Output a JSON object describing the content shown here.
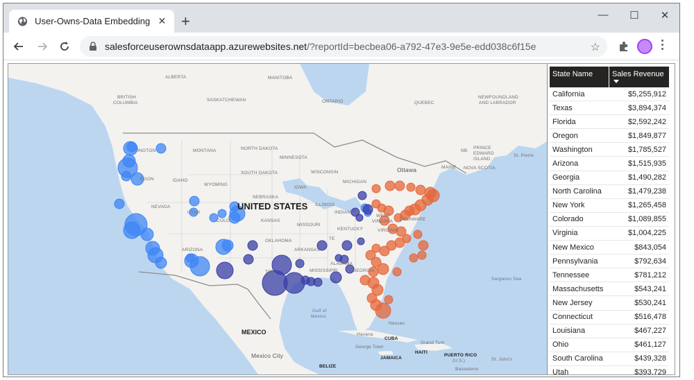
{
  "browser": {
    "tab_title": "User-Owns-Data Embedding App",
    "tab_close": "✕",
    "new_tab": "+",
    "window": {
      "minimize": "—",
      "maximize": "☐",
      "close": "✕"
    },
    "url_host": "salesforceuserownsdataapp.azurewebsites.net",
    "url_path": "/?reportId=becbea06-a792-47e3-9e5e-edd038c6f15e"
  },
  "map": {
    "labels": {
      "alberta": "ALBERTA",
      "manitoba": "MANITOBA",
      "british_columbia_1": "BRITISH",
      "british_columbia_2": "COLUMBIA",
      "saskatchewan": "SASKATCHEWAN",
      "ontario": "ONTARIO",
      "quebec": "QUEBEC",
      "newfoundland_1": "NEWFOUNDLAND",
      "newfoundland_2": "AND LABRADOR",
      "washington": "INGTON",
      "montana": "MONTANA",
      "north_dakota": "NORTH DAKOTA",
      "minnesota": "MINNESOTA",
      "south_dakota": "SOUTH DAKOTA",
      "wisconsin": "WISCONSIN",
      "idaho": "IDAHO",
      "wyoming": "WYOMING",
      "oregon": "EGON",
      "iowa": "IOWA",
      "michigan": "MICHIGAN",
      "nebraska": "NEBRASKA",
      "nevada": "NEVADA",
      "utah": "UTAH",
      "illinois": "ILLINOIS",
      "indiana": "INDIAN",
      "colorado": "COLO",
      "kansas": "KANSAS",
      "missouri": "MISSOURI",
      "kentucky": "KENTUCKY",
      "west_virginia_1": "WEST",
      "west_virginia_2": "VIRGINIA",
      "virginia": "VIRGINIA",
      "delaware": "DELAWARE",
      "oklahoma": "OKLAHOMA",
      "arkansas": "ARKANSAS",
      "tennessee": "TE",
      "arizona": "ARIZONA",
      "texas": "TEX",
      "mississippi": "MISSISSIPPI",
      "alabama": "ALABAMA",
      "georgia": "GEORGIA",
      "nb": "NB",
      "prince_edward_1": "PRINCE",
      "prince_edward_2": "EDWARD",
      "prince_edward_3": "ISLAND",
      "maine": "MAINE",
      "nova_scotia": "NOVA SCOTIA",
      "st_pierre": "St. Pierre",
      "ottawa": "Ottawa",
      "sargasso": "Sargasso Sea",
      "gulf_1": "Gulf of",
      "gulf_2": "Mexico",
      "nassau": "Nassau",
      "havana": "Havana",
      "cuba": "CUBA",
      "grand_turk": "Grand Turk",
      "george_town": "George Town",
      "haiti": "HAITI",
      "puerto_rico_1": "PUERTO RICO",
      "puerto_rico_2": "(U.S.)",
      "st_johns": "St. John's",
      "basseterre": "Basseterre",
      "jamaica": "JAMAICA",
      "mexico": "MEXICO",
      "mexico_city": "Mexico City",
      "belize": "BELIZE"
    },
    "country_title": "UNITED STATES",
    "colors": {
      "blue": "#3f86f5",
      "navy": "#3a3fa6",
      "orange": "#e5673a",
      "water": "#bcd6f0",
      "land": "#f3f2ef"
    }
  },
  "table": {
    "col1": "State Name",
    "col2": "Sales Revenue",
    "rows": [
      {
        "state": "California",
        "revenue": "$5,255,912"
      },
      {
        "state": "Texas",
        "revenue": "$3,894,374"
      },
      {
        "state": "Florida",
        "revenue": "$2,592,242"
      },
      {
        "state": "Oregon",
        "revenue": "$1,849,877"
      },
      {
        "state": "Washington",
        "revenue": "$1,785,527"
      },
      {
        "state": "Arizona",
        "revenue": "$1,515,935"
      },
      {
        "state": "Georgia",
        "revenue": "$1,490,282"
      },
      {
        "state": "North Carolina",
        "revenue": "$1,479,238"
      },
      {
        "state": "New York",
        "revenue": "$1,265,458"
      },
      {
        "state": "Colorado",
        "revenue": "$1,089,855"
      },
      {
        "state": "Virginia",
        "revenue": "$1,004,225"
      },
      {
        "state": "New Mexico",
        "revenue": "$843,054"
      },
      {
        "state": "Pennsylvania",
        "revenue": "$792,634"
      },
      {
        "state": "Tennessee",
        "revenue": "$781,212"
      },
      {
        "state": "Massachusetts",
        "revenue": "$543,241"
      },
      {
        "state": "New Jersey",
        "revenue": "$530,241"
      },
      {
        "state": "Connecticut",
        "revenue": "$516,478"
      },
      {
        "state": "Louisiana",
        "revenue": "$467,227"
      },
      {
        "state": "Ohio",
        "revenue": "$461,127"
      },
      {
        "state": "South Carolina",
        "revenue": "$439,328"
      },
      {
        "state": "Utah",
        "revenue": "$393,729"
      }
    ]
  }
}
